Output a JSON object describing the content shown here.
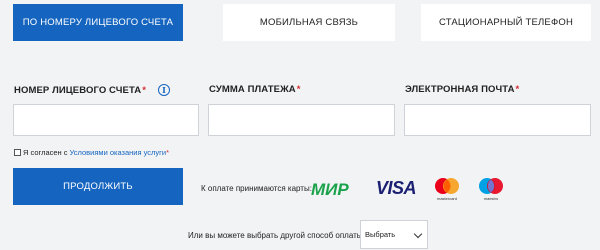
{
  "tabs": [
    {
      "label": "ПО НОМЕРУ ЛИЦЕВОГО СЧЕТА",
      "active": true
    },
    {
      "label": "МОБИЛЬНАЯ СВЯЗЬ",
      "active": false
    },
    {
      "label": "СТАЦИОНАРНЫЙ ТЕЛЕФОН",
      "active": false
    }
  ],
  "form": {
    "account_label": "НОМЕР ЛИЦЕВОГО СЧЕТА",
    "amount_label": "СУММА ПЛАТЕЖА",
    "email_label": "ЭЛЕКТРОННАЯ ПОЧТА",
    "required_mark": "*",
    "account_value": "",
    "amount_value": "",
    "email_value": "",
    "info_glyph": "i"
  },
  "agreement": {
    "prefix": "Я согласен с",
    "link": "Условиями оказания услуги",
    "required_mark": "*",
    "checked": false
  },
  "actions": {
    "continue_label": "ПРОДОЛЖИТЬ"
  },
  "payment": {
    "accepted_label": "К оплате принимаются карты:",
    "logos": [
      "mir-logo",
      "visa-logo",
      "mastercard-logo",
      "maestro-logo"
    ],
    "mir_text": "МИР",
    "visa_text": "VISA",
    "mastercard_text": "mastercard",
    "maestro_text": "maestro"
  },
  "alternative": {
    "label": "Или вы можете выбрать другой способ оплаты:",
    "select_value": "Выбрать"
  },
  "colors": {
    "accent": "#1565c0",
    "required": "#d32f2f",
    "mir_green": "#1aa34a",
    "mc_red": "#eb001b",
    "mc_orange": "#f79e1b",
    "maestro_blue": "#00a2e5"
  }
}
